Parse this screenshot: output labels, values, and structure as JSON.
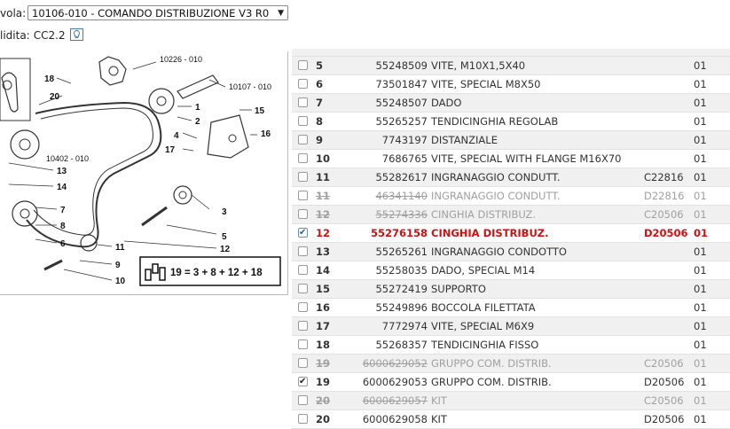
{
  "header": {
    "tavola_label": "vola:",
    "tavola_value": "10106-010 - COMANDO DISTRIBUZIONE V3 R0",
    "validita_label": "lidita:",
    "validita_value": "CC2.2"
  },
  "diagram": {
    "labels": [
      "18",
      "20",
      "10226 - 010",
      "10107 - 010",
      "1",
      "2",
      "15",
      "16",
      "4",
      "17",
      "10402 - 010",
      "13",
      "14",
      "7",
      "8",
      "6",
      "3",
      "5",
      "11",
      "12",
      "9",
      "10"
    ],
    "formula": "19 = 3 + 8 + 12 + 18"
  },
  "rows": [
    {
      "no": "5",
      "pn": "55248509",
      "desc": "VITE, M10X1,5X40",
      "code": "",
      "qty": "01",
      "state": "normal",
      "checked": false
    },
    {
      "no": "6",
      "pn": "73501847",
      "desc": "VITE, SPECIAL M8X50",
      "code": "",
      "qty": "01",
      "state": "normal",
      "checked": false
    },
    {
      "no": "7",
      "pn": "55248507",
      "desc": "DADO",
      "code": "",
      "qty": "01",
      "state": "normal",
      "checked": false
    },
    {
      "no": "8",
      "pn": "55265257",
      "desc": "TENDICINGHIA REGOLAB",
      "code": "",
      "qty": "01",
      "state": "normal",
      "checked": false
    },
    {
      "no": "9",
      "pn": "7743197",
      "desc": "DISTANZIALE",
      "code": "",
      "qty": "01",
      "state": "normal",
      "checked": false
    },
    {
      "no": "10",
      "pn": "7686765",
      "desc": "VITE, SPECIAL WITH FLANGE M16X70",
      "code": "",
      "qty": "01",
      "state": "normal",
      "checked": false
    },
    {
      "no": "11",
      "pn": "55282617",
      "desc": "INGRANAGGIO CONDUTT.",
      "code": "C22816",
      "qty": "01",
      "state": "normal",
      "checked": false
    },
    {
      "no": "11",
      "pn": "46341140",
      "desc": "INGRANAGGIO CONDUTT.",
      "code": "D22816",
      "qty": "01",
      "state": "old",
      "checked": false
    },
    {
      "no": "12",
      "pn": "55274336",
      "desc": "CINGHIA DISTRIBUZ.",
      "code": "C20506",
      "qty": "01",
      "state": "old",
      "checked": false
    },
    {
      "no": "12",
      "pn": "55276158",
      "desc": "CINGHIA DISTRIBUZ.",
      "code": "D20506",
      "qty": "01",
      "state": "red",
      "checked": true
    },
    {
      "no": "13",
      "pn": "55265261",
      "desc": "INGRANAGGIO CONDOTTO",
      "code": "",
      "qty": "01",
      "state": "normal",
      "checked": false
    },
    {
      "no": "14",
      "pn": "55258035",
      "desc": "DADO, SPECIAL M14",
      "code": "",
      "qty": "01",
      "state": "normal",
      "checked": false
    },
    {
      "no": "15",
      "pn": "55272419",
      "desc": "SUPPORTO",
      "code": "",
      "qty": "01",
      "state": "normal",
      "checked": false
    },
    {
      "no": "16",
      "pn": "55249896",
      "desc": "BOCCOLA FILETTATA",
      "code": "",
      "qty": "01",
      "state": "normal",
      "checked": false
    },
    {
      "no": "17",
      "pn": "7772974",
      "desc": "VITE, SPECIAL M6X9",
      "code": "",
      "qty": "01",
      "state": "normal",
      "checked": false
    },
    {
      "no": "18",
      "pn": "55268357",
      "desc": "TENDICINGHIA FISSO",
      "code": "",
      "qty": "01",
      "state": "normal",
      "checked": false
    },
    {
      "no": "19",
      "pn": "6000629052",
      "desc": "GRUPPO COM. DISTRIB.",
      "code": "C20506",
      "qty": "01",
      "state": "old",
      "checked": false
    },
    {
      "no": "19",
      "pn": "6000629053",
      "desc": "GRUPPO COM. DISTRIB.",
      "code": "D20506",
      "qty": "01",
      "state": "normal",
      "checked": true
    },
    {
      "no": "20",
      "pn": "6000629057",
      "desc": "KIT",
      "code": "C20506",
      "qty": "01",
      "state": "old",
      "checked": false
    },
    {
      "no": "20",
      "pn": "6000629058",
      "desc": "KIT",
      "code": "D20506",
      "qty": "01",
      "state": "normal",
      "checked": false
    }
  ]
}
